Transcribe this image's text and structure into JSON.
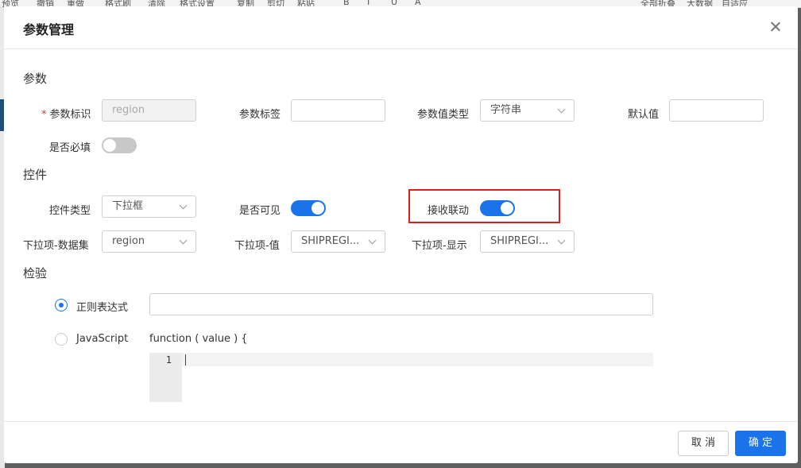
{
  "background_app": {
    "toolbar_items": [
      "预览",
      "撤销",
      "重做",
      "格式刷",
      "清除",
      "格式设置",
      "复制",
      "剪切",
      "粘贴",
      "B",
      "I",
      "U",
      "A",
      "全部折叠",
      "大数据",
      "自适应"
    ]
  },
  "dialog": {
    "title": "参数管理",
    "close_icon": "close-icon",
    "sections": {
      "params": {
        "title": "参数",
        "id_label": "参数标识",
        "id_value": "region",
        "tag_label": "参数标签",
        "tag_value": "",
        "type_label": "参数值类型",
        "type_value": "字符串",
        "default_label": "默认值",
        "default_value": "",
        "required_label": "是否必填",
        "required_on": false
      },
      "widget": {
        "title": "控件",
        "type_label": "控件类型",
        "type_value": "下拉框",
        "visible_label": "是否可见",
        "visible_on": true,
        "linkage_label": "接收联动",
        "linkage_on": true,
        "dataset_label": "下拉项-数据集",
        "dataset_value": "region",
        "value_label": "下拉项-值",
        "value_value": "SHIPREGI...",
        "display_label": "下拉项-显示",
        "display_value": "SHIPREGI..."
      },
      "validation": {
        "title": "检验",
        "regex_label": "正则表达式",
        "regex_checked": true,
        "regex_value": "",
        "js_label": "JavaScript",
        "js_checked": false,
        "function_signature": "function ( value ) {",
        "line_number": "1"
      }
    },
    "footer": {
      "cancel_label": "取 消",
      "ok_label": "确 定"
    },
    "colors": {
      "primary": "#1a73e8",
      "highlight": "#e02020",
      "required": "#e33333"
    }
  }
}
